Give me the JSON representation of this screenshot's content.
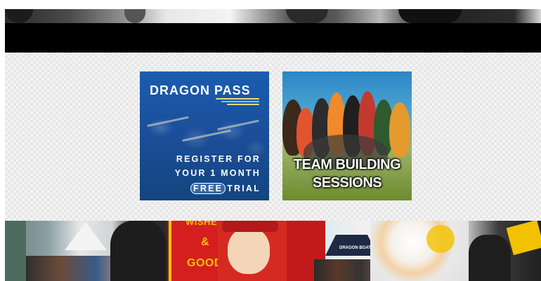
{
  "promo_section": {
    "dragon_pass": {
      "title": "DRAGON PASS",
      "line1": "REGISTER FOR",
      "line2": "YOUR 1 MONTH",
      "free": "FREE",
      "trial": "TRIAL"
    },
    "team_building": {
      "line1": "TEAM BUILDING",
      "line2": "SESSIONS"
    }
  },
  "bottom_photo": {
    "banner_line1": "WISHES",
    "banner_line2": "&",
    "banner_line3": "GOOD",
    "boat_sign": "DRAGON BOAT"
  },
  "colors": {
    "brand_blue": "#1b4f9b",
    "banner_red": "#d51f1f",
    "banner_gold": "#f2c200"
  }
}
